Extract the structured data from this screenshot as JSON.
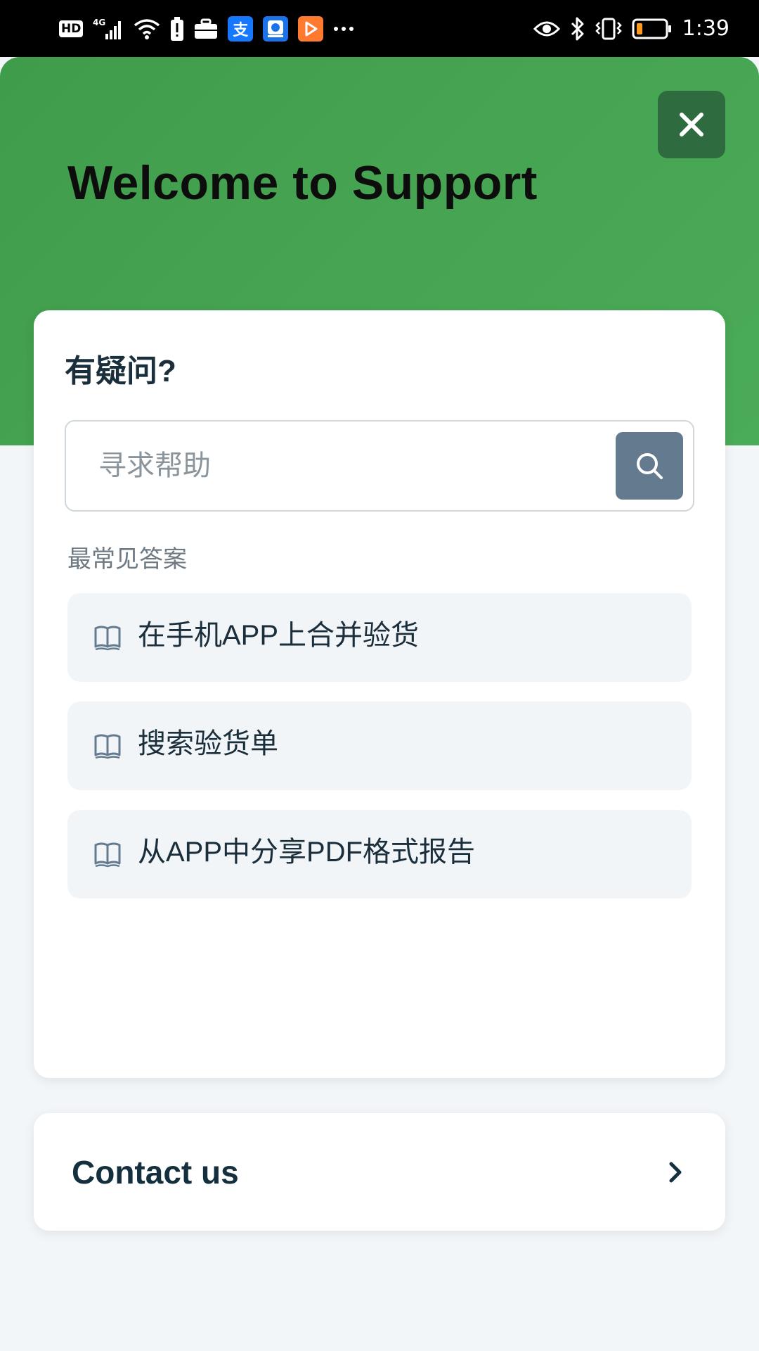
{
  "status_bar": {
    "hd": "HD",
    "network": "4G",
    "app_alipay_glyph": "支",
    "time": "1:39"
  },
  "header": {
    "title": "Welcome to Support",
    "gradient_start": "#3e9c4a",
    "gradient_end": "#4aab58",
    "close_icon": "close-icon"
  },
  "faq_card": {
    "title": "有疑问?",
    "search": {
      "placeholder": "寻求帮助",
      "value": "",
      "button_icon": "search-icon",
      "button_color": "#647a8f"
    },
    "section_label": "最常见答案",
    "items": [
      {
        "label": "在手机APP上合并验货",
        "icon": "book-icon"
      },
      {
        "label": "搜索验货单",
        "icon": "book-icon"
      },
      {
        "label": "从APP中分享PDF格式报告",
        "icon": "book-icon"
      }
    ]
  },
  "contact": {
    "label": "Contact us",
    "icon": "chevron-right-icon"
  }
}
